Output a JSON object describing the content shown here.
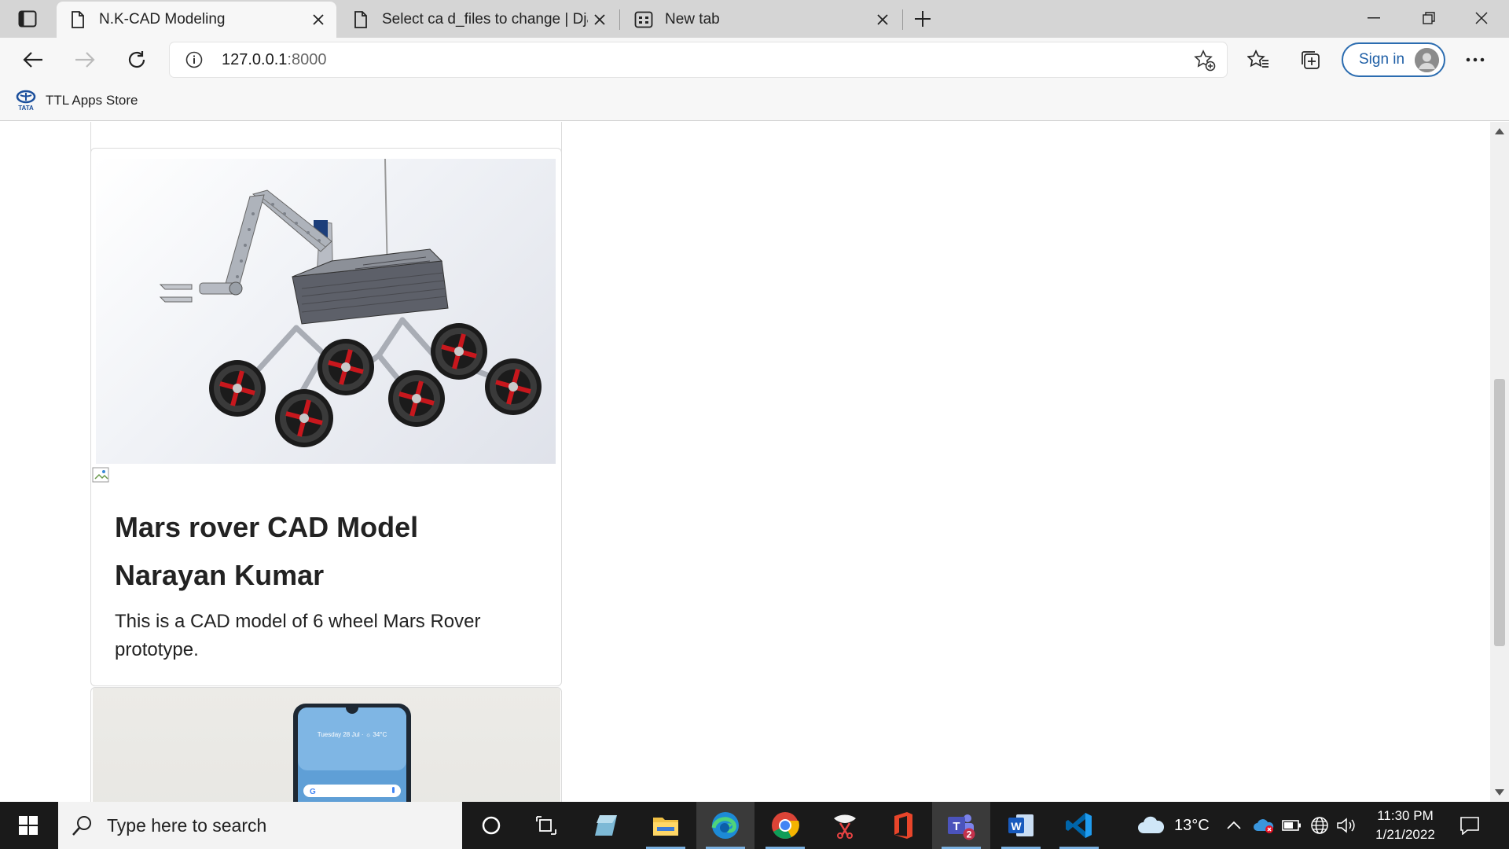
{
  "browser": {
    "tabs": [
      {
        "title": "N.K-CAD Modeling",
        "active": true,
        "icon": "page-icon"
      },
      {
        "title": "Select ca d_files to change | Djan",
        "active": false,
        "icon": "page-icon"
      },
      {
        "title": "New tab",
        "active": false,
        "icon": "newtab-page-icon"
      }
    ],
    "address": {
      "host": "127.0.0.1",
      "port": ":8000"
    },
    "signin_label": "Sign in",
    "favorites": [
      {
        "label": "TTL Apps Store",
        "icon": "tata-logo-icon",
        "icon_text": "TATA"
      }
    ]
  },
  "page": {
    "card": {
      "title": "Mars rover CAD Model",
      "author": "Narayan Kumar",
      "description": "This is a CAD model of 6 wheel Mars Rover prototype."
    },
    "next_card_phone": {
      "screen_text": "Tuesday 28 Jul · ☼ 34°C"
    }
  },
  "taskbar": {
    "search_placeholder": "Type here to search",
    "weather": {
      "temp": "13°C",
      "icon": "cloud-icon"
    },
    "clock": {
      "time": "11:30 PM",
      "date": "1/21/2022"
    },
    "teams_badge": "2",
    "apps": [
      "cortana-icon",
      "task-view-icon",
      "app-icon",
      "file-explorer-icon",
      "edge-icon",
      "chrome-icon",
      "snipping-tool-icon",
      "office-icon",
      "teams-icon",
      "word-icon",
      "vscode-icon"
    ]
  },
  "colors": {
    "tabstrip": "#d5d5d5",
    "toolbar": "#f7f7f7",
    "taskbar": "#1a1a1a",
    "signin_accent": "#1f5fa6",
    "rover_red": "#c8171d"
  }
}
